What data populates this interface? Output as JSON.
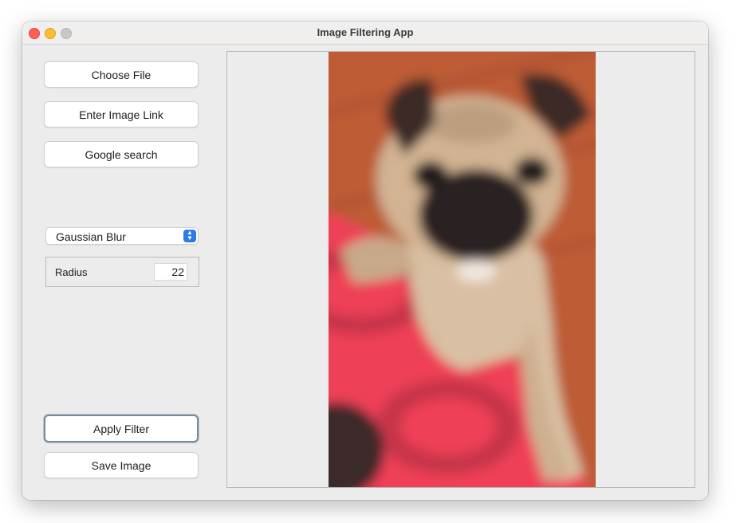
{
  "window": {
    "title": "Image Filtering App"
  },
  "sidebar": {
    "choose_file_label": "Choose File",
    "image_link_label": "Enter Image Link",
    "google_search_label": "Google search",
    "filter_select": {
      "selected": "Gaussian Blur"
    },
    "parameter": {
      "label": "Radius",
      "value": "22"
    },
    "apply_label": "Apply Filter",
    "save_label": "Save Image"
  },
  "preview": {
    "image_subject": "blurred photo of a pug puppy on a red patterned couch"
  },
  "colors": {
    "window_bg": "#ececec",
    "select_accent": "#2d7be5",
    "close": "#ff5f57",
    "minimize": "#febc2e",
    "maximize": "#c9c8c7"
  }
}
